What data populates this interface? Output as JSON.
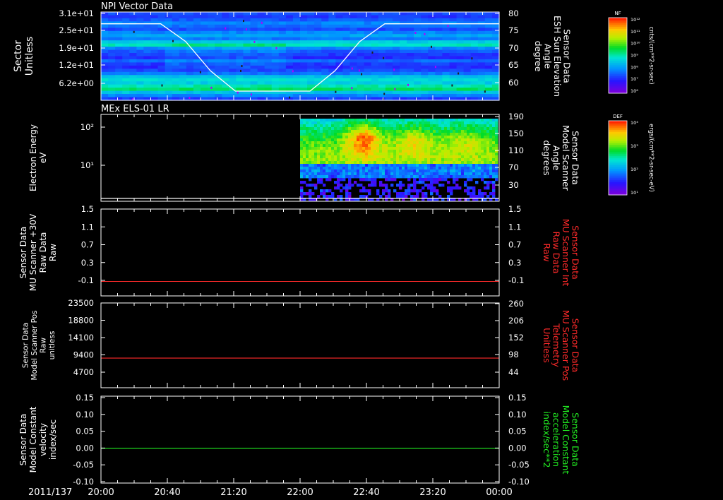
{
  "panels": [
    {
      "id": "npi",
      "title": "NPI Vector Data",
      "left_label_lines": [
        "Sector",
        "Unitless"
      ],
      "left_ticks": [
        "3.1e+01",
        "2.5e+01",
        "1.9e+01",
        "1.2e+01",
        "6.2e+00"
      ],
      "right_label_lines": [
        "Sensor Data",
        "ESH Sun Elevation",
        "Angle",
        "degree"
      ],
      "right_ticks": [
        "80",
        "75",
        "70",
        "65",
        "60"
      ],
      "right_label_color": "#ffffff",
      "line_color": "#ffffff"
    },
    {
      "id": "els",
      "title": "MEx ELS-01 LR",
      "left_label_lines": [
        "Electron Energy",
        "eV"
      ],
      "left_ticks": [
        "10²",
        "10¹"
      ],
      "right_label_lines": [
        "Sensor Data",
        "Model Scanner",
        "Angle",
        "degrees"
      ],
      "right_ticks": [
        "190",
        "150",
        "110",
        "70",
        "30"
      ],
      "right_label_color": "#ffffff",
      "line_color": "#ffffff"
    },
    {
      "id": "mu_int",
      "title": "",
      "left_label_lines": [
        "Sensor Data",
        "MU Scanner +30V",
        "Raw Data",
        "Raw"
      ],
      "left_ticks": [
        "1.5",
        "1.1",
        "0.7",
        "0.3",
        "-0.1"
      ],
      "right_label_lines": [
        "Sensor Data",
        "MU Scanner Int",
        "Raw Data",
        "Raw"
      ],
      "right_ticks": [
        "1.5",
        "1.1",
        "0.7",
        "0.3",
        "-0.1"
      ],
      "right_label_color": "#ff2a2a",
      "line_color": "#ff2a2a"
    },
    {
      "id": "mu_pos",
      "title": "",
      "left_label_lines": [
        "Sensor Data",
        "Model Scanner Pos",
        "Raw",
        "unitless"
      ],
      "left_ticks": [
        "23500",
        "18800",
        "14100",
        "9400",
        "4700"
      ],
      "right_label_lines": [
        "Sensor Data",
        "MU Scanner Pos",
        "Telemetry",
        "Unitless"
      ],
      "right_ticks": [
        "260",
        "206",
        "152",
        "98",
        "44"
      ],
      "right_label_color": "#ff2a2a",
      "line_color": "#ff2a2a"
    },
    {
      "id": "model_const",
      "title": "",
      "left_label_lines": [
        "Sensor Data",
        "Model Constant",
        "velocity",
        "index/sec"
      ],
      "left_ticks": [
        "0.15",
        "0.10",
        "0.05",
        "0.00",
        "-0.05",
        "-0.10"
      ],
      "right_label_lines": [
        "Sensor Data",
        "Model Constant",
        "acceleration",
        "index/sec**2"
      ],
      "right_ticks": [
        "0.15",
        "0.10",
        "0.05",
        "0.00",
        "-0.05",
        "-0.10"
      ],
      "right_label_color": "#22ee22",
      "line_color": "#22ee22"
    }
  ],
  "time_axis": {
    "date": "2011/137",
    "ticks": [
      "20:00",
      "20:40",
      "21:20",
      "22:00",
      "22:40",
      "23:20",
      "00:00"
    ]
  },
  "colorbars": [
    {
      "label": "NF",
      "unit": "cnts/(cm**2-sr-sec)",
      "ticks": [
        "10¹²",
        "10¹¹",
        "10¹⁰",
        "10⁹",
        "10⁸",
        "10⁷",
        "10⁶"
      ]
    },
    {
      "label": "DEF",
      "unit": "ergs/(cm**2-sr-sec-eV)",
      "ticks": [
        "10⁴",
        "10³",
        "10²",
        "10¹"
      ]
    }
  ],
  "chart_data": [
    {
      "type": "heatmap",
      "title": "NPI Vector Data",
      "ylabel": "Sector Unitless",
      "ylim": [
        0,
        31
      ],
      "y2label": "Sensor Data ESH Sun Elevation Angle degree",
      "y2lim": [
        56,
        80
      ],
      "x": [
        "20:00",
        "20:40",
        "21:20",
        "22:00",
        "22:40",
        "23:20",
        "00:00"
      ],
      "overlay_line": {
        "name": "ESH Sun Elevation Angle",
        "x_hours": [
          0.0,
          0.6,
          0.85,
          1.1,
          1.35,
          1.6,
          1.85,
          2.1,
          2.35,
          2.6,
          2.85,
          3.2,
          4.0
        ],
        "values": [
          76.8,
          76.8,
          72,
          64,
          58.5,
          58.5,
          58.5,
          58.5,
          64,
          72,
          76.8,
          76.8,
          76.8
        ]
      }
    },
    {
      "type": "heatmap",
      "title": "MEx ELS-01 LR",
      "ylabel": "Electron Energy eV",
      "scale": "log",
      "ylim": [
        1,
        180
      ],
      "y2label": "Sensor Data Model Scanner Angle degrees",
      "y2lim": [
        10,
        190
      ],
      "data_start": "22:00",
      "overlay_line": {
        "name": "Model Scanner Angle",
        "values": [
          16,
          16
        ]
      }
    },
    {
      "type": "line",
      "ylabel": "Sensor Data MU Scanner +30V Raw Data Raw",
      "ylim": [
        -0.3,
        1.5
      ],
      "series": [
        {
          "values": [
            0.0,
            0.0
          ]
        }
      ]
    },
    {
      "type": "line",
      "ylabel": "Sensor Data Model Scanner Pos Raw unitless",
      "ylim": [
        0,
        23500
      ],
      "y2lim": [
        0,
        260
      ],
      "series": [
        {
          "values": [
            8200,
            8200
          ]
        }
      ]
    },
    {
      "type": "line",
      "ylabel": "Sensor Data Model Constant velocity index/sec",
      "ylim": [
        -0.1,
        0.15
      ],
      "series": [
        {
          "values": [
            0.0,
            0.0
          ]
        }
      ]
    }
  ]
}
